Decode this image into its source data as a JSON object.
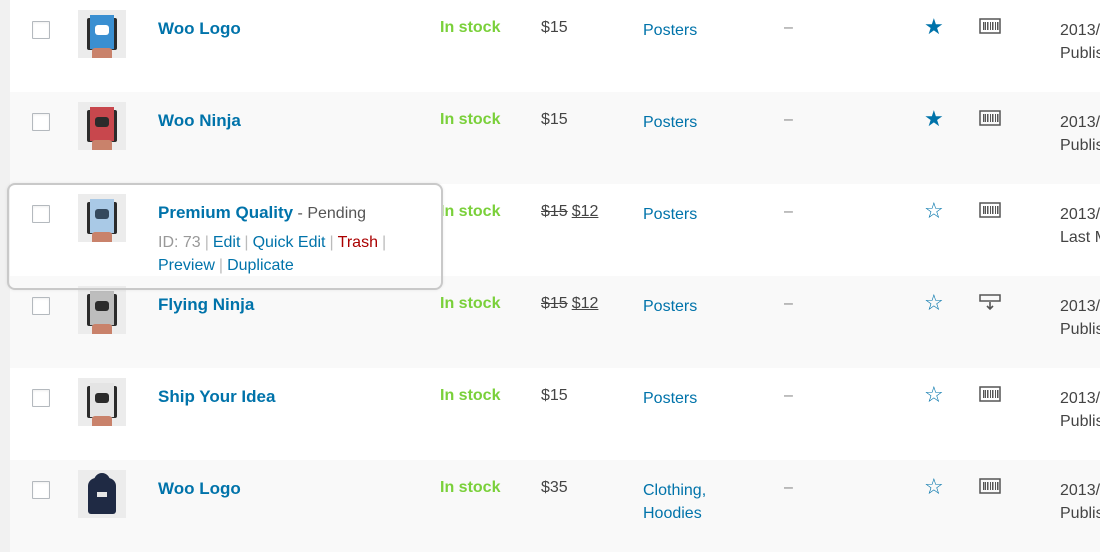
{
  "rows": [
    {
      "name": "Woo Logo",
      "status_note": "",
      "stock": "In stock",
      "price_old": "",
      "price": "$15",
      "categories": [
        "Posters"
      ],
      "tags": "–",
      "featured": true,
      "date_line1": "2013/",
      "date_line2": "Publis",
      "thumb": "poster",
      "poster_color": "#3a8fd1",
      "mark_color": "#ffffff",
      "type_icon": "barcode-icon"
    },
    {
      "name": "Woo Ninja",
      "status_note": "",
      "stock": "In stock",
      "price_old": "",
      "price": "$15",
      "categories": [
        "Posters"
      ],
      "tags": "–",
      "featured": true,
      "date_line1": "2013/",
      "date_line2": "Publis",
      "thumb": "poster",
      "poster_color": "#c8474d",
      "mark_color": "#2b2b2b",
      "type_icon": "barcode-icon"
    },
    {
      "name": "Premium Quality",
      "status_note": " - Pending",
      "stock": "In stock",
      "price_old": "$15",
      "price": "$12",
      "categories": [
        "Posters"
      ],
      "tags": "–",
      "featured": false,
      "date_line1": "2013/",
      "date_line2": "Last M",
      "thumb": "poster",
      "poster_color": "#a9c9e6",
      "mark_color": "#34495e",
      "type_icon": "barcode-icon",
      "actions": {
        "id_label": "ID: 73",
        "edit": "Edit",
        "quick_edit": "Quick Edit",
        "trash": "Trash",
        "preview": "Preview",
        "duplicate": "Duplicate"
      }
    },
    {
      "name": "Flying Ninja",
      "status_note": "",
      "stock": "In stock",
      "price_old": "$15",
      "price": "$12",
      "categories": [
        "Posters"
      ],
      "tags": "–",
      "featured": false,
      "date_line1": "2013/",
      "date_line2": "Publis",
      "thumb": "poster",
      "poster_color": "#bdbdbd",
      "mark_color": "#2b2b2b",
      "type_icon": "download-icon"
    },
    {
      "name": "Ship Your Idea",
      "status_note": "",
      "stock": "In stock",
      "price_old": "",
      "price": "$15",
      "categories": [
        "Posters"
      ],
      "tags": "–",
      "featured": false,
      "date_line1": "2013/",
      "date_line2": "Publis",
      "thumb": "poster",
      "poster_color": "#e4e4e4",
      "mark_color": "#2b2b2b",
      "type_icon": "barcode-icon"
    },
    {
      "name": "Woo Logo",
      "status_note": "",
      "stock": "In stock",
      "price_old": "",
      "price": "$35",
      "categories": [
        "Clothing,",
        "Hoodies"
      ],
      "tags": "–",
      "featured": false,
      "date_line1": "2013/",
      "date_line2": "Publis",
      "thumb": "hoodie",
      "poster_color": "#1f2a44",
      "mark_color": "#e6e6e6",
      "type_icon": "barcode-icon"
    }
  ],
  "icons": {
    "star_filled": "★",
    "star_empty": "☆"
  },
  "colors": {
    "link": "#0073aa",
    "in_stock": "#7ad03a",
    "trash": "#aa0000"
  }
}
